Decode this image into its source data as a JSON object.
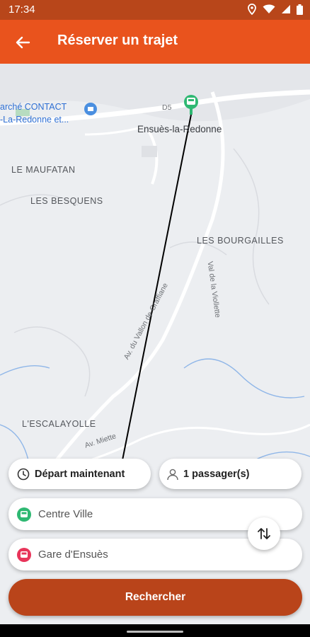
{
  "status_bar": {
    "time": "17:34",
    "icons": [
      "location-icon",
      "wifi-icon",
      "signal-icon",
      "battery-icon"
    ]
  },
  "app_bar": {
    "title": "Réserver un trajet",
    "back_icon": "arrow-back-icon"
  },
  "map": {
    "labels": {
      "poi_line1": "arché CONTACT",
      "poi_line2": "-La-Redonne et...",
      "town": "Ensuès-la-Redonne",
      "road_d5": "D5",
      "le_maufatan": "LE MAUFATAN",
      "les_besquens": "LES BESQUENS",
      "les_bourgailles": "LES BOURGAILLES",
      "val_viollette": "Val de la Viollette",
      "av_vallon": "Av. du Vallon de Graffiane",
      "lescalayolle": "L'ESCALAYOLLE",
      "av_miette": "Av. Miette"
    },
    "route_color": "#000000",
    "stop_marker_color": "#2eb872",
    "end_marker_color": "#e8345a"
  },
  "controls": {
    "departure_label": "Départ maintenant",
    "passengers_label": "1 passager(s)",
    "origin_value": "Centre Ville",
    "destination_value": "Gare d'Ensuès",
    "search_label": "Rechercher"
  },
  "colors": {
    "accent": "#e9531d",
    "dark_accent": "#b9441a",
    "origin_icon": "#2eb872",
    "destination_icon": "#e8345a"
  }
}
